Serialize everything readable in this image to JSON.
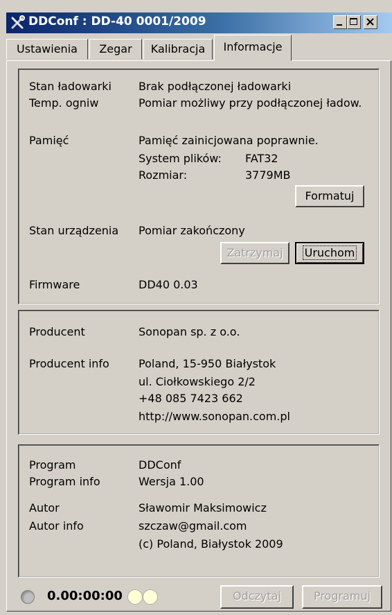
{
  "window": {
    "title": "DDConf : DD-40 0001/2009",
    "minimize_icon": "minimize-icon",
    "maximize_icon": "maximize-icon",
    "close_icon": "close-icon"
  },
  "tabs": [
    {
      "label": "Ustawienia",
      "active": false
    },
    {
      "label": "Zegar",
      "active": false
    },
    {
      "label": "Kalibracja",
      "active": false
    },
    {
      "label": "Informacje",
      "active": true
    }
  ],
  "device": {
    "charger_status_label": "Stan ładowarki",
    "charger_status_value": "Brak podłączonej ładowarki",
    "cell_temp_label": "Temp. ogniw",
    "cell_temp_value": "Pomiar możliwy przy podłączonej ładow.",
    "memory_label": "Pamięć",
    "memory_value": "Pamięć zainicjowana poprawnie.",
    "filesystem_label": "System plików:",
    "filesystem_value": "FAT32",
    "size_label": "Rozmiar:",
    "size_value": "3779MB",
    "format_button": "Formatuj",
    "state_label": "Stan urządzenia",
    "state_value": "Pomiar zakończony",
    "stop_button": "Zatrzymaj",
    "start_button": "Uruchom",
    "firmware_label": "Firmware",
    "firmware_value": "DD40 0.03"
  },
  "producer": {
    "label": "Producent",
    "value": "Sonopan sp. z o.o.",
    "info_label": "Producent info",
    "info_lines": [
      "Poland, 15-950 Białystok",
      "ul. Ciołkowskiego 2/2",
      "+48 085 7423 662",
      "http://www.sonopan.com.pl"
    ]
  },
  "program": {
    "label": "Program",
    "value": "DDConf",
    "info_label": "Program info",
    "info_value": "Wersja 1.00",
    "author_label": "Autor",
    "author_value": "Sławomir Maksimowicz",
    "author_info_label": "Autor info",
    "author_info_lines": [
      "szczaw@gmail.com",
      "(c) Poland, Białystok 2009"
    ]
  },
  "status_bar": {
    "timer": "0.00:00:00",
    "read_button": "Odczytaj",
    "program_button": "Programuj",
    "led_colors": {
      "status": "#c0c0c0",
      "indicator_a": "#ffffd8",
      "indicator_b": "#ffffd8"
    }
  },
  "colors": {
    "title_start": "#0a246a",
    "title_end": "#a6caf0",
    "face": "#d4d0c8"
  }
}
